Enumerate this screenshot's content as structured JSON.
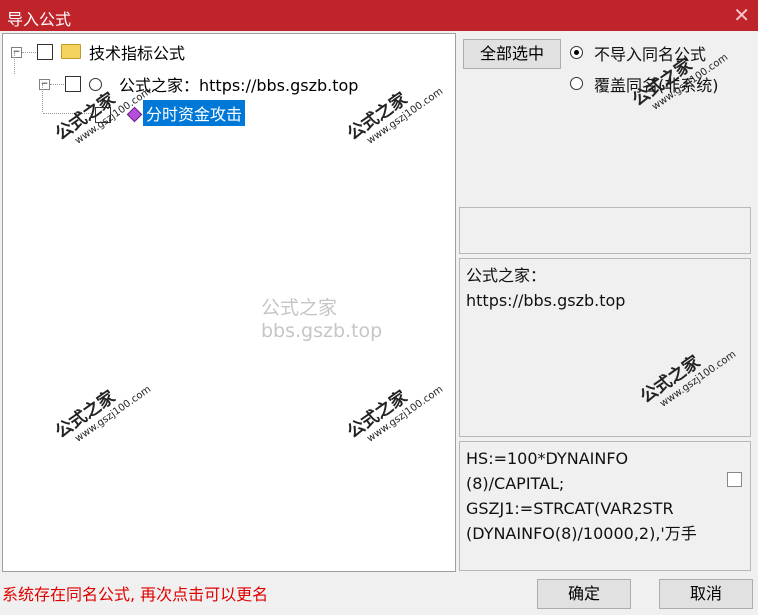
{
  "window": {
    "title": "导入公式",
    "close_glyph": "✕"
  },
  "tree": {
    "root_label": "技术指标公式",
    "group_label": "公式之家：https://bbs.gszb.top",
    "item_label": "分时资金攻击"
  },
  "actions": {
    "select_all": "全部选中",
    "radio_no_import": "不导入同名公式",
    "radio_overwrite": "覆盖同名(非系统)"
  },
  "info": {
    "line1": "公式之家：",
    "line2": "https://bbs.gszb.top"
  },
  "code_preview": {
    "lines": [
      "HS:=100*DYNAINFO",
      "(8)/CAPITAL;",
      "GSZJ1:=STRCAT(VAR2STR",
      "(DYNAINFO(8)/10000,2),'万手"
    ]
  },
  "status_text": "系统存在同名公式, 再次点击可以更名",
  "buttons": {
    "ok": "确定",
    "cancel": "取消"
  },
  "watermark": {
    "center": "公式之家 bbs.gszb.top",
    "stamp_big": "公式之家",
    "stamp_small": "www.gszj100.com"
  },
  "colors": {
    "titlebar": "#c0242b",
    "selection": "#0078d7",
    "status": "#e00000"
  }
}
